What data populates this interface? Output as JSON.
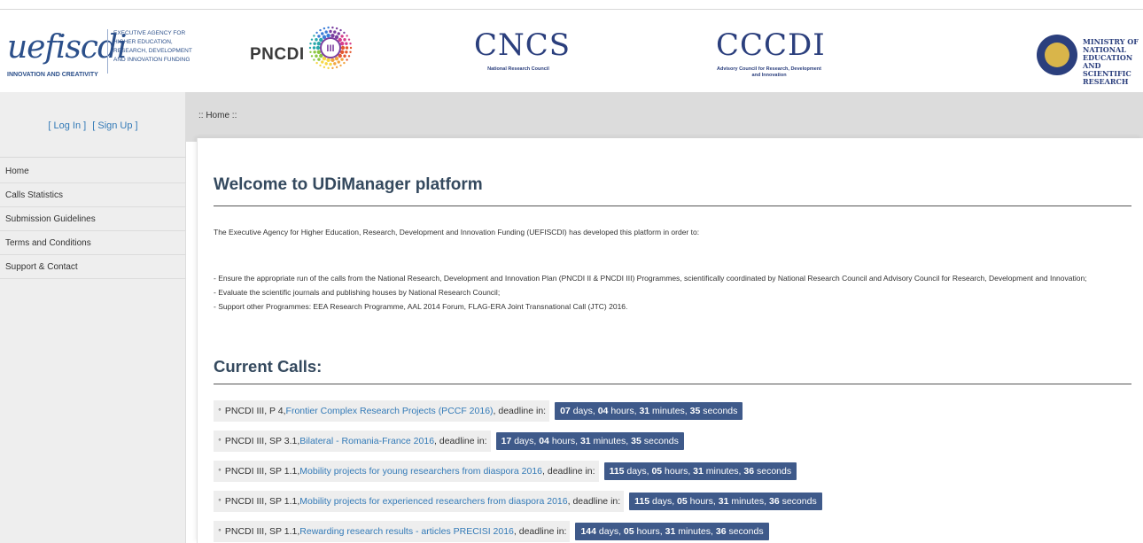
{
  "header": {
    "uefiscdi": {
      "script": "uefiscdi",
      "agency": "EXECUTIVE AGENCY FOR\nHIGHER EDUCATION,\nRESEARCH, DEVELOPMENT\nAND INNOVATION FUNDING",
      "tagline": "INNOVATION AND CREATIVITY"
    },
    "pncdi": {
      "text": "PNCDI",
      "numeral": "III"
    },
    "cncs": {
      "text": "CNCS",
      "sub": "National Research Council"
    },
    "cccdi": {
      "text": "CCCDI",
      "sub": "Advisory Council for Research, Development and Innovation"
    },
    "ministry": {
      "text": "MINISTRY OF\nNATIONAL\nEDUCATION\nAND SCIENTIFIC\nRESEARCH"
    }
  },
  "auth": {
    "login": "[ Log In ]",
    "signup": "[ Sign Up ]"
  },
  "nav": {
    "items": [
      "Home",
      "Calls Statistics",
      "Submission Guidelines",
      "Terms and Conditions",
      "Support & Contact"
    ]
  },
  "breadcrumb": ":: Home ::",
  "main": {
    "title": "Welcome to UDiManager platform",
    "intro": "The Executive Agency for Higher Education, Research, Development and Innovation Funding (UEFISCDI) has developed this platform in order to:",
    "bullets": [
      "- Ensure the appropriate run of the calls from the National Research, Development and Innovation Plan (PNCDI II & PNCDI III) Programmes, scientifically coordinated by National Research Council and Advisory Council for Research, Development and Innovation;",
      "- Evaluate the scientific journals and publishing houses by National Research Council;",
      "- Support other Programmes: EEA Research Programme, AAL 2014 Forum, FLAG-ERA Joint Transnational Call (JTC) 2016."
    ],
    "calls_title": "Current Calls:",
    "calls": [
      {
        "prefix": "PNCDI III, P 4, ",
        "link": "Frontier Complex Research Projects (PCCF 2016)",
        "suffix": ", deadline in:",
        "days": "07",
        "hours": "04",
        "minutes": "31",
        "seconds": "35"
      },
      {
        "prefix": "PNCDI III, SP 3.1, ",
        "link": "Bilateral - Romania-France 2016",
        "suffix": ", deadline in:",
        "days": "17",
        "hours": "04",
        "minutes": "31",
        "seconds": "35"
      },
      {
        "prefix": "PNCDI III, SP 1.1, ",
        "link": "Mobility projects for young researchers from diaspora 2016",
        "suffix": ", deadline in:",
        "days": "115",
        "hours": "05",
        "minutes": "31",
        "seconds": "36"
      },
      {
        "prefix": "PNCDI III, SP 1.1, ",
        "link": "Mobility projects for experienced researchers from diaspora 2016",
        "suffix": ", deadline in:",
        "days": "115",
        "hours": "05",
        "minutes": "31",
        "seconds": "36"
      },
      {
        "prefix": "PNCDI III, SP 1.1, ",
        "link": "Rewarding research results - articles PRECISI 2016",
        "suffix": ", deadline in:",
        "days": "144",
        "hours": "05",
        "minutes": "31",
        "seconds": "36"
      }
    ],
    "units": {
      "days": " days, ",
      "hours": " hours, ",
      "minutes": " minutes, ",
      "seconds": " seconds"
    }
  },
  "colors": {
    "link": "#337ab7",
    "countdown_bg": "#3f5a8a",
    "sidebar_bg": "#eeeeee",
    "heading": "#34495e"
  }
}
